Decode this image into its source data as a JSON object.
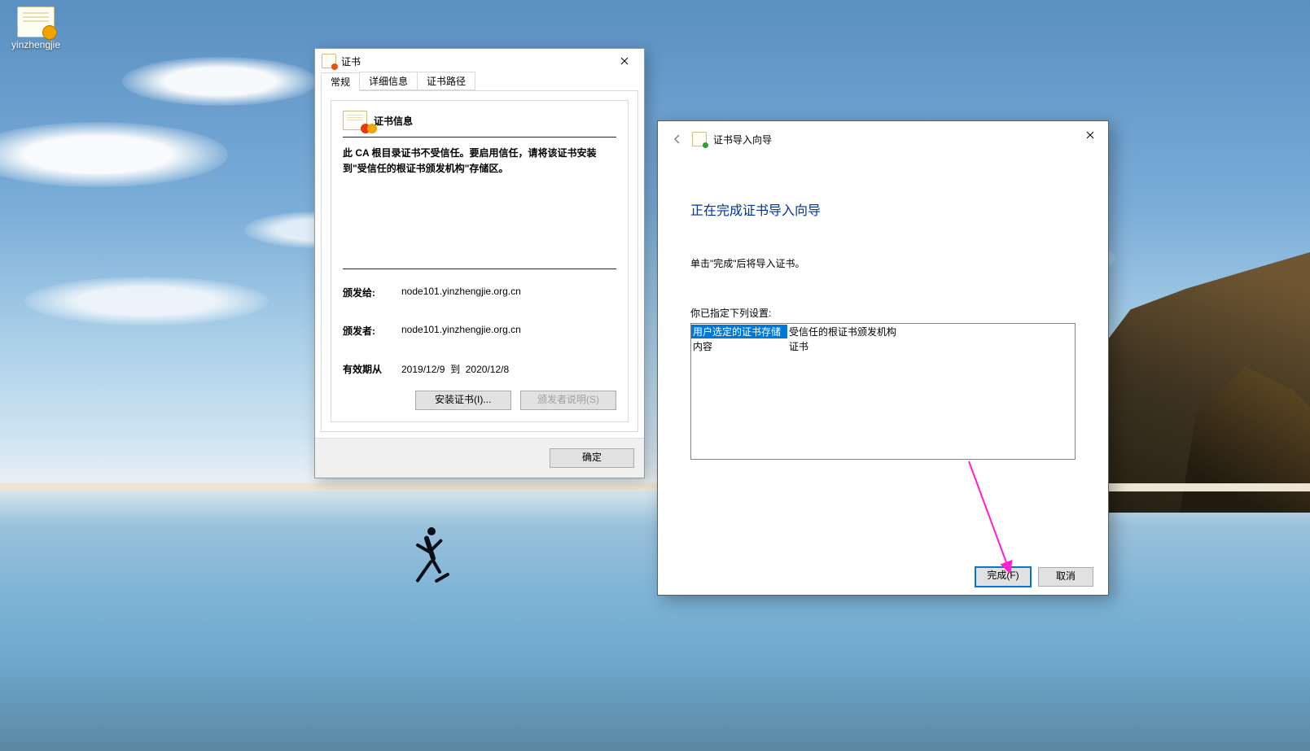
{
  "desktop": {
    "icon_label": "yinzhengjie"
  },
  "cert": {
    "title": "证书",
    "tabs": {
      "general": "常规",
      "details": "详细信息",
      "path": "证书路径"
    },
    "info_heading": "证书信息",
    "warn": "此 CA 根目录证书不受信任。要启用信任，请将该证书安装到\"受信任的根证书颁发机构\"存储区。",
    "issued_to_label": "颁发给:",
    "issued_to_value": "node101.yinzhengjie.org.cn",
    "issued_by_label": "颁发者:",
    "issued_by_value": "node101.yinzhengjie.org.cn",
    "valid_label": "有效期从",
    "valid_from": "2019/12/9",
    "valid_to_word": "到",
    "valid_to": "2020/12/8",
    "install_btn": "安装证书(I)...",
    "issuer_stmt_btn": "颁发者说明(S)",
    "ok_btn": "确定"
  },
  "wizard": {
    "window_title": "证书导入向导",
    "heading": "正在完成证书导入向导",
    "desc": "单击\"完成\"后将导入证书。",
    "settings_label": "你已指定下列设置:",
    "rows": [
      {
        "k": "用户选定的证书存储",
        "v": "受信任的根证书颁发机构"
      },
      {
        "k": "内容",
        "v": "证书"
      }
    ],
    "finish_btn": "完成(F)",
    "cancel_btn": "取消"
  }
}
